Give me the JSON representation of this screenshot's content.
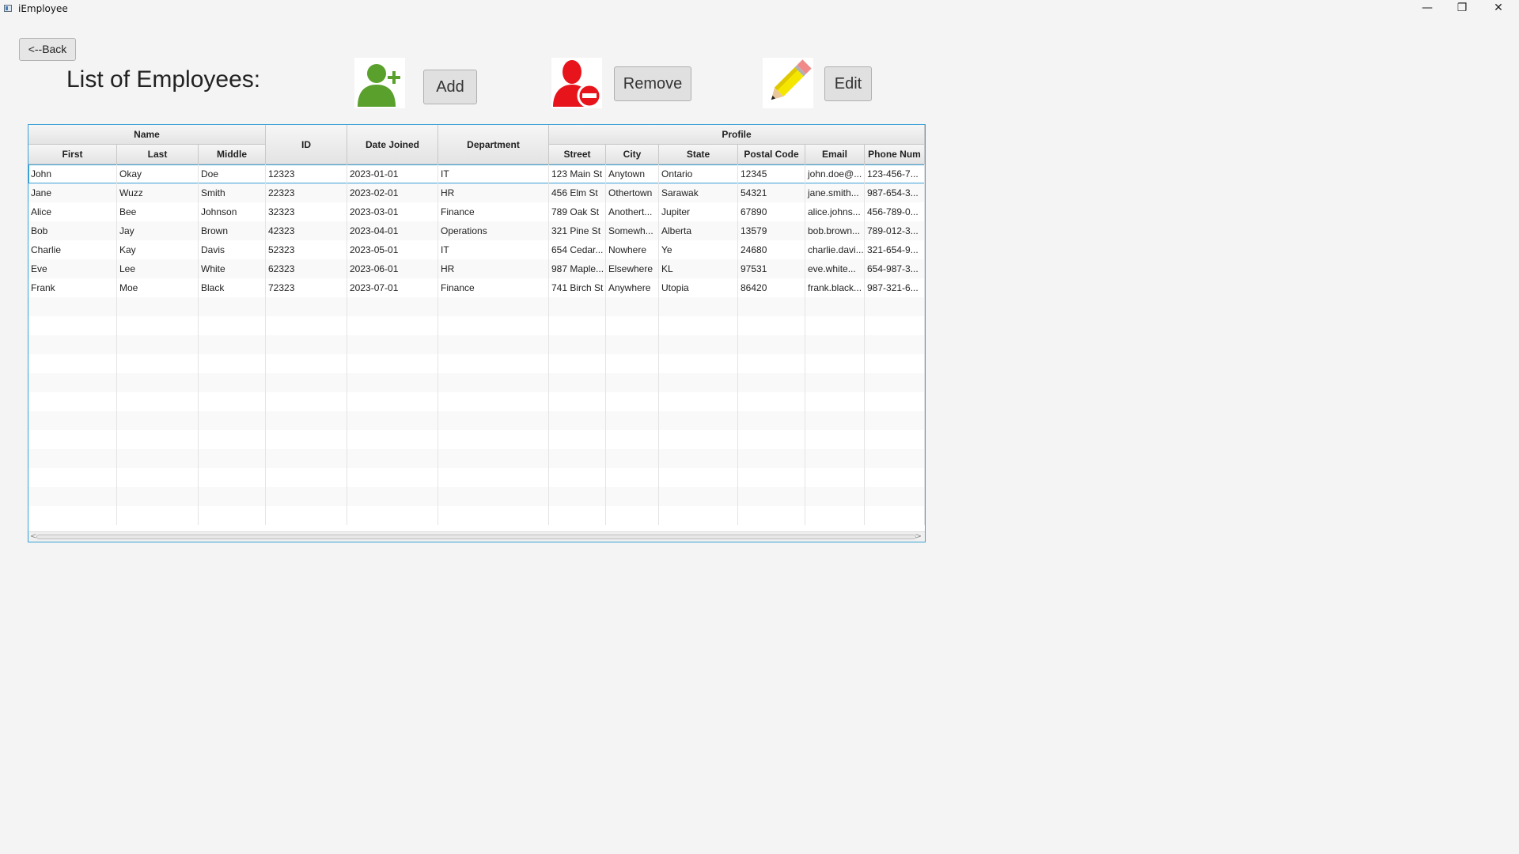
{
  "window": {
    "title": "iEmployee",
    "minimize_glyph": "—",
    "maximize_glyph": "❐",
    "close_glyph": "✕"
  },
  "toolbar": {
    "back_label": "<--Back",
    "page_title": "List of Employees:",
    "add_label": "Add",
    "remove_label": "Remove",
    "edit_label": "Edit",
    "icons": [
      "add-user-icon",
      "remove-user-icon",
      "pencil-icon"
    ]
  },
  "colors": {
    "selection_border": "#3aa0d6",
    "add_icon": "#5aa02c",
    "remove_icon": "#e8141c",
    "pencil_body": "#f5e600"
  },
  "table": {
    "groups": {
      "name": "Name",
      "profile": "Profile"
    },
    "columns": [
      "First",
      "Last",
      "Middle",
      "ID",
      "Date Joined",
      "Department",
      "Street",
      "City",
      "State",
      "Postal Code",
      "Email",
      "Phone Num"
    ],
    "rows": [
      [
        "John",
        "Okay",
        "Doe",
        "12323",
        "2023-01-01",
        "IT",
        "123 Main St",
        "Anytown",
        "Ontario",
        "12345",
        "john.doe@...",
        "123-456-7..."
      ],
      [
        "Jane",
        "Wuzz",
        "Smith",
        "22323",
        "2023-02-01",
        "HR",
        "456 Elm St",
        "Othertown",
        "Sarawak",
        "54321",
        "jane.smith...",
        "987-654-3..."
      ],
      [
        "Alice",
        "Bee",
        "Johnson",
        "32323",
        "2023-03-01",
        "Finance",
        "789 Oak St",
        "Anothert...",
        "Jupiter",
        "67890",
        "alice.johns...",
        "456-789-0..."
      ],
      [
        "Bob",
        "Jay",
        "Brown",
        "42323",
        "2023-04-01",
        "Operations",
        "321 Pine St",
        "Somewh...",
        "Alberta",
        "13579",
        "bob.brown...",
        "789-012-3..."
      ],
      [
        "Charlie",
        "Kay",
        "Davis",
        "52323",
        "2023-05-01",
        "IT",
        "654 Cedar...",
        "Nowhere",
        "Ye",
        "24680",
        "charlie.davi...",
        "321-654-9..."
      ],
      [
        "Eve",
        "Lee",
        "White",
        "62323",
        "2023-06-01",
        "HR",
        "987 Maple...",
        "Elsewhere",
        "KL",
        "97531",
        "eve.white...",
        "654-987-3..."
      ],
      [
        "Frank",
        "Moe",
        "Black",
        "72323",
        "2023-07-01",
        "Finance",
        "741 Birch St",
        "Anywhere",
        "Utopia",
        "86420",
        "frank.black...",
        "987-321-6..."
      ]
    ],
    "selected_row": 0,
    "scroll_left_glyph": "<",
    "scroll_right_glyph": ">"
  }
}
